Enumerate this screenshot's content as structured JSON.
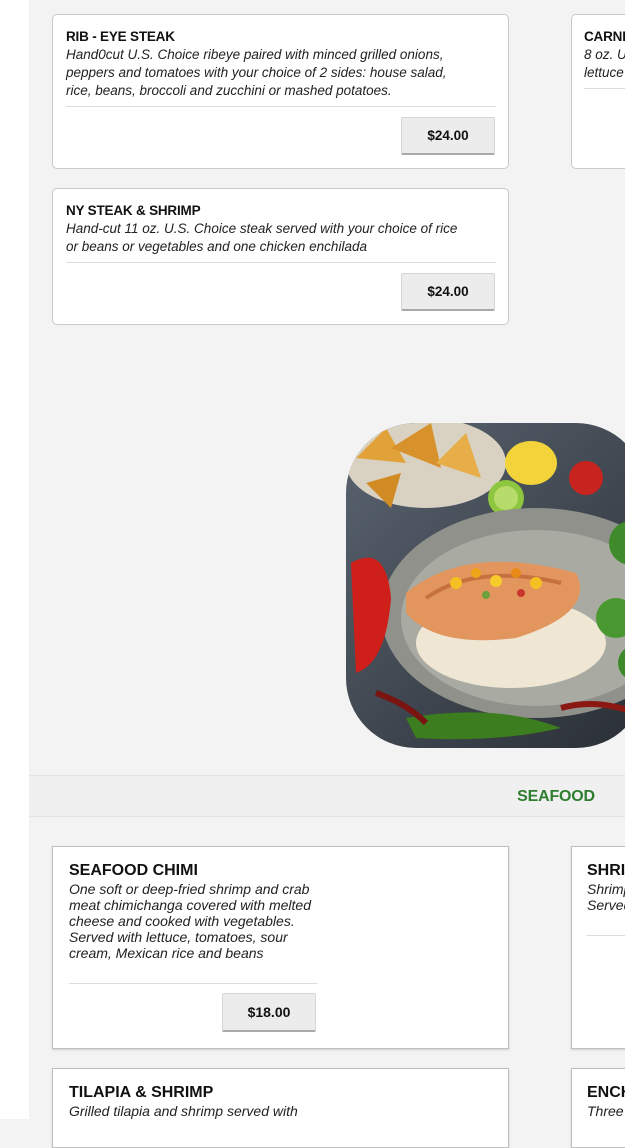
{
  "steaks": [
    {
      "name": "RIB - EYE STEAK",
      "desc_lines": [
        "Hand0cut U.S. Choice ribeye paired with minced grilled onions,",
        "peppers and tomatoes with your choice of 2 sides: house salad,",
        "rice, beans, broccoli and zucchini or mashed potatoes."
      ],
      "price": "$24.00"
    },
    {
      "name": "NY STEAK & SHRIMP",
      "desc_lines": [
        "Hand-cut 11 oz. U.S. Choice steak served with your choice of rice",
        "or beans or vegetables and one chicken enchilada"
      ],
      "price": "$24.00"
    },
    {
      "name": "CARNI",
      "desc_lines": [
        "8 oz. U",
        "lettuce"
      ]
    }
  ],
  "section": {
    "title": "SEAFOOD"
  },
  "seafood": [
    {
      "name": "SEAFOOD CHIMI",
      "desc_lines": [
        "One soft or deep-fried shrimp and crab",
        "meat chimichanga covered with melted",
        "cheese and cooked with vegetables.",
        "Served with lettuce, tomatoes, sour",
        "cream, Mexican rice and beans"
      ],
      "price": "$18.00"
    },
    {
      "name": "SHRI",
      "desc_lines": [
        "Shrimp",
        "Served"
      ]
    },
    {
      "name": "TILAPIA & SHRIMP",
      "desc_lines": [
        "Grilled tilapia and shrimp served with"
      ]
    },
    {
      "name": "ENCH",
      "desc_lines": [
        "Three"
      ]
    }
  ],
  "colors": {
    "section_title": "#2f7d2f",
    "background": "#f3f3f3"
  }
}
